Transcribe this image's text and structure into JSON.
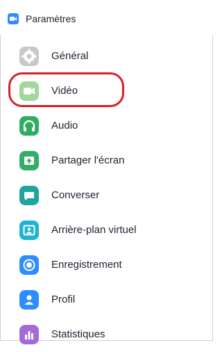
{
  "window": {
    "title": "Paramètres"
  },
  "sidebar": {
    "items": [
      {
        "label": "Général",
        "icon": "gear-icon",
        "color": "#c8c8c8"
      },
      {
        "label": "Vidéo",
        "icon": "video-camera-icon",
        "color": "#9fd89a"
      },
      {
        "label": "Audio",
        "icon": "headphones-icon",
        "color": "#2fae62"
      },
      {
        "label": "Partager l'écran",
        "icon": "share-screen-icon",
        "color": "#35ad6a"
      },
      {
        "label": "Converser",
        "icon": "chat-bubble-icon",
        "color": "#1fa59d"
      },
      {
        "label": "Arrière-plan virtuel",
        "icon": "virtual-background-icon",
        "color": "#1eb4d0"
      },
      {
        "label": "Enregistrement",
        "icon": "record-icon",
        "color": "#2d8cff"
      },
      {
        "label": "Profil",
        "icon": "profile-icon",
        "color": "#2d8cff"
      },
      {
        "label": "Statistiques",
        "icon": "statistics-icon",
        "color": "#a36bd8"
      }
    ],
    "selected_label": "Vidéo"
  },
  "colors": {
    "highlight": "#d8202a",
    "app_accent": "#2d8cff"
  }
}
